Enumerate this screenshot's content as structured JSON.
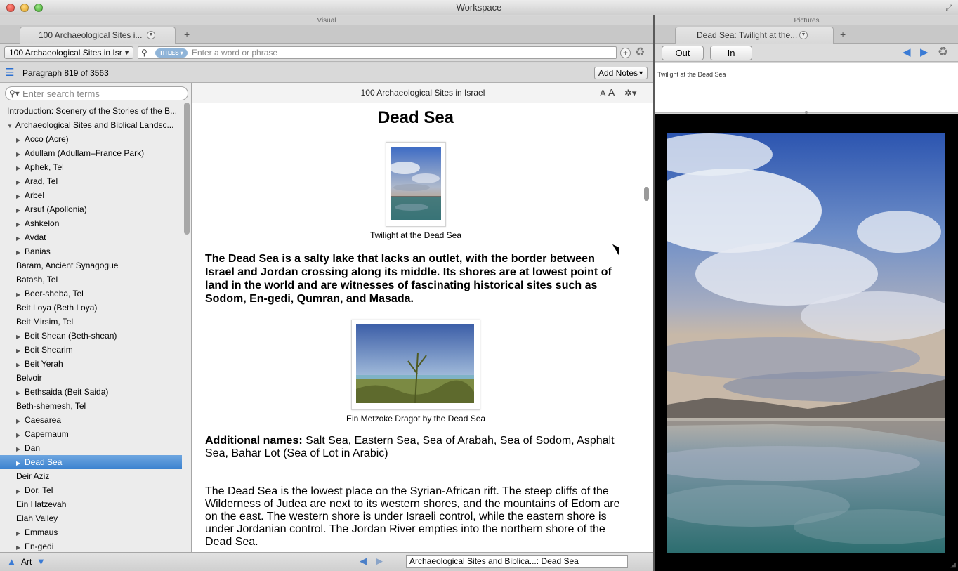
{
  "window": {
    "title": "Workspace"
  },
  "visual_pane": {
    "header": "Visual",
    "tab_label": "100 Archaeological Sites i...",
    "book_select": "100 Archaeological Sites in Isr",
    "search_scope": "TITLES",
    "search_placeholder": "Enter a word or phrase",
    "paragraph_status": "Paragraph 819 of 3563",
    "add_notes_label": "Add Notes"
  },
  "toc": {
    "search_placeholder": "Enter search terms",
    "items": [
      {
        "label": "Introduction: Scenery of the Stories of the B...",
        "expander": "none",
        "level": 0
      },
      {
        "label": "Archaeological Sites and Biblical Landsc...",
        "expander": "open",
        "level": 0
      },
      {
        "label": "Acco (Acre)",
        "expander": "closed",
        "level": 1
      },
      {
        "label": "Adullam (Adullam–France Park)",
        "expander": "closed",
        "level": 1
      },
      {
        "label": "Aphek, Tel",
        "expander": "closed",
        "level": 1
      },
      {
        "label": "Arad, Tel",
        "expander": "closed",
        "level": 1
      },
      {
        "label": "Arbel",
        "expander": "closed",
        "level": 1
      },
      {
        "label": "Arsuf (Apollonia)",
        "expander": "closed",
        "level": 1
      },
      {
        "label": "Ashkelon",
        "expander": "closed",
        "level": 1
      },
      {
        "label": "Avdat",
        "expander": "closed",
        "level": 1
      },
      {
        "label": "Banias",
        "expander": "closed",
        "level": 1
      },
      {
        "label": "Baram, Ancient Synagogue",
        "expander": "none",
        "level": 1
      },
      {
        "label": "Batash, Tel",
        "expander": "none",
        "level": 1
      },
      {
        "label": "Beer-sheba, Tel",
        "expander": "closed",
        "level": 1
      },
      {
        "label": "Beit Loya (Beth Loya)",
        "expander": "none",
        "level": 1
      },
      {
        "label": "Beit Mirsim, Tel",
        "expander": "none",
        "level": 1
      },
      {
        "label": "Beit Shean (Beth-shean)",
        "expander": "closed",
        "level": 1
      },
      {
        "label": "Beit Shearim",
        "expander": "closed",
        "level": 1
      },
      {
        "label": "Beit Yerah",
        "expander": "closed",
        "level": 1
      },
      {
        "label": "Belvoir",
        "expander": "none",
        "level": 1
      },
      {
        "label": "Bethsaida (Beit Saida)",
        "expander": "closed",
        "level": 1
      },
      {
        "label": "Beth-shemesh, Tel",
        "expander": "none",
        "level": 1
      },
      {
        "label": "Caesarea",
        "expander": "closed",
        "level": 1
      },
      {
        "label": "Capernaum",
        "expander": "closed",
        "level": 1
      },
      {
        "label": "Dan",
        "expander": "closed",
        "level": 1
      },
      {
        "label": "Dead Sea",
        "expander": "closed",
        "level": 1,
        "selected": true
      },
      {
        "label": "Deir Aziz",
        "expander": "none",
        "level": 1
      },
      {
        "label": "Dor, Tel",
        "expander": "closed",
        "level": 1
      },
      {
        "label": "Ein Hatzevah",
        "expander": "none",
        "level": 1
      },
      {
        "label": "Elah Valley",
        "expander": "none",
        "level": 1
      },
      {
        "label": "Emmaus",
        "expander": "closed",
        "level": 1
      },
      {
        "label": "En-gedi",
        "expander": "closed",
        "level": 1
      }
    ]
  },
  "reader": {
    "book_title": "100 Archaeological Sites in Israel",
    "font_size_small": "A",
    "font_size_large": "A",
    "article_title": "Dead Sea",
    "figure1_caption": "Twilight at the Dead Sea",
    "lead_paragraph": "The Dead Sea is a salty lake that lacks an outlet, with the border between Israel and Jordan crossing along its middle. Its shores are at lowest point of land in the world and are witnesses of fascinating historical sites such as Sodom, En-gedi, Qumran, and Masada.",
    "figure2_caption": "Ein Metzoke Dragot by the Dead Sea",
    "additional_names_label": "Additional names:",
    "additional_names": "Salt Sea, Eastern Sea, Sea of Arabah, Sea of Sodom, Asphalt Sea, Bahar Lot (Sea of Lot in Arabic)",
    "body_paragraph": "The Dead Sea is the lowest place on the Syrian-African rift. The steep cliffs of the Wilderness of Judea are next to its western shores, and the mountains of Edom are on the east. The western shore is under Israeli control, while the eastern shore is under Jordanian control. The Jordan River empties into the northern shore of the Dead Sea."
  },
  "bottom_bar": {
    "label": "Art",
    "location": "Archaeological Sites and Biblica...: Dead Sea"
  },
  "pictures_pane": {
    "header": "Pictures",
    "tab_label": "Dead Sea: Twilight at the...",
    "zoom_out_label": "Out",
    "zoom_in_label": "In",
    "caption": "Twilight at the Dead Sea"
  },
  "colors": {
    "selection": "#3b82cf",
    "accent_blue": "#3a7bd5"
  }
}
